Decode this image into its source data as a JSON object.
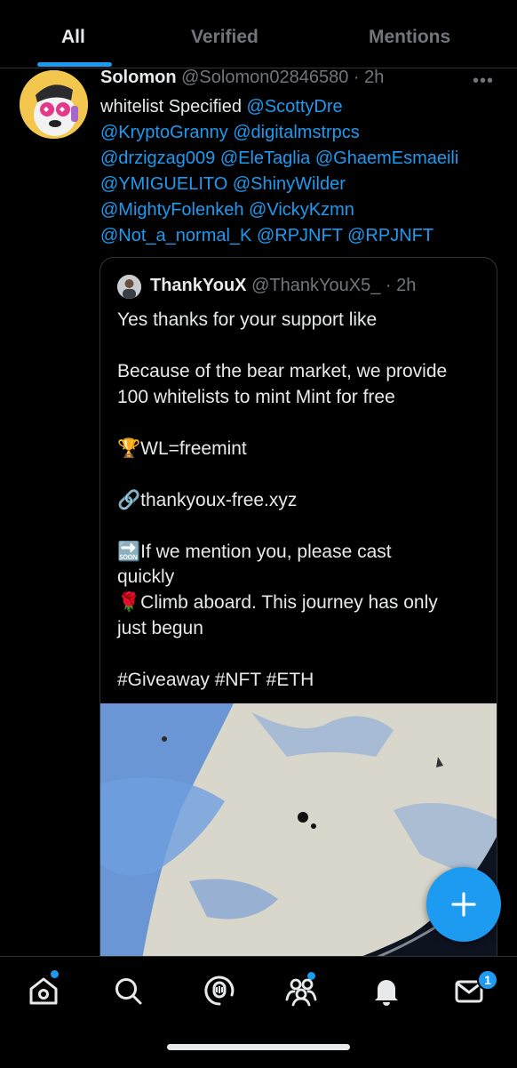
{
  "tabs": [
    {
      "label": "All",
      "active": true
    },
    {
      "label": "Verified",
      "active": false
    },
    {
      "label": "Mentions",
      "active": false
    }
  ],
  "tweet": {
    "author_name": "Solomon",
    "author_handle": "@Solomon02846580",
    "time": "· 2h",
    "lines": [
      {
        "plain": "whitelist Specified ",
        "link": "@ScottyDre"
      },
      {
        "plain": "",
        "link": "@KryptoGranny @digitalmstrpcs"
      },
      {
        "plain": "",
        "link": "@drzigzag009 @EleTaglia @GhaemEsmaeili"
      },
      {
        "plain": "",
        "link": "@YMIGUELITO @ShinyWilder"
      },
      {
        "plain": "",
        "link": "@MightyFolenkeh @VickyKzmn"
      },
      {
        "plain": "",
        "link": "@Not_a_normal_K @RPJNFT @RPJNFT"
      }
    ]
  },
  "quote": {
    "author_name": "ThankYouX",
    "author_handle": "@ThankYouX5_",
    "time": "· 2h",
    "lines": [
      "Yes thanks for your support like",
      "Because of the bear market, we provide",
      "100 whitelists to mint Mint for free",
      "🏆WL=freemint",
      "🔗thankyoux-free.xyz",
      "🔜If we mention you, please cast",
      "quickly",
      "🌹Climb aboard. This journey has only",
      "just begun",
      "#Giveaway #NFT #ETH"
    ]
  },
  "fab": {
    "label": "+",
    "icon": "compose-plus-icon"
  },
  "bottom_nav": {
    "items": [
      "home-icon",
      "search-icon",
      "spaces-icon",
      "communities-icon",
      "notifications-icon",
      "messages-icon"
    ],
    "messages_badge": "1"
  },
  "colors": {
    "accent": "#1d9bf0",
    "background": "#000000",
    "muted": "#71767b",
    "text": "#e7e9ea"
  }
}
